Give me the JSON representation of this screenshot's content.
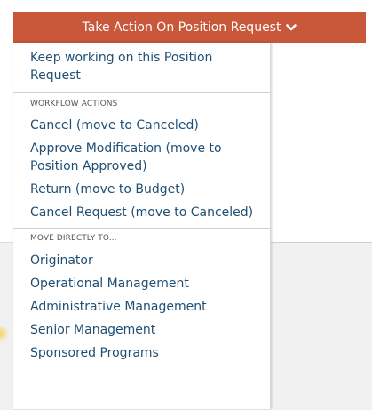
{
  "action_button": {
    "label": "Take Action On Position Request"
  },
  "menu": {
    "keep_working": "Keep working on this Position Request",
    "workflow_header": "WORKFLOW ACTIONS",
    "workflow_items": [
      "Cancel (move to Canceled)",
      "Approve Modification (move to Position Approved)",
      "Return (move to Budget)",
      "Cancel Request (move to Canceled)"
    ],
    "move_header": "MOVE DIRECTLY TO...",
    "move_items": [
      "Originator",
      "Operational Management",
      "Administrative Management",
      "Senior Management",
      "Sponsored Programs"
    ]
  },
  "colors": {
    "button_bg": "#c9573a",
    "link_text": "#1f4f74"
  },
  "icons": {
    "button_icon": "chevron-down-icon"
  }
}
